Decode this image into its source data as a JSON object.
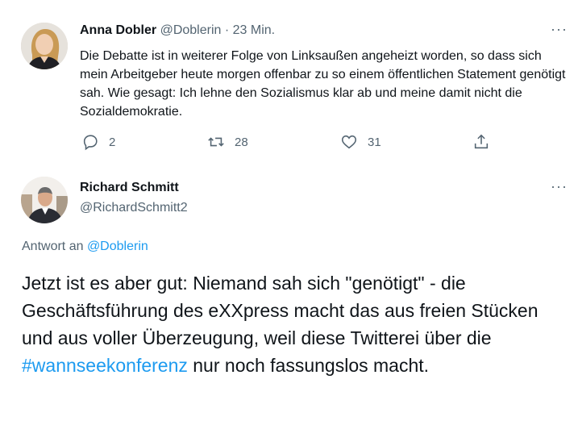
{
  "tweet1": {
    "author_name": "Anna Dobler",
    "handle": "@Doblerin",
    "separator": "·",
    "time": "23 Min.",
    "more": "···",
    "text": "Die Debatte ist in weiterer Folge von Linksaußen angeheizt worden, so dass sich mein Arbeitgeber heute morgen offenbar zu so einem öffentlichen Statement genötigt sah. Wie gesagt: Ich lehne den Sozialismus klar ab und meine damit nicht die Sozialdemokratie.",
    "replies": "2",
    "retweets": "28",
    "likes": "31"
  },
  "tweet2": {
    "author_name": "Richard Schmitt",
    "handle": "@RichardSchmitt2",
    "more": "···",
    "reply_to_label": "Antwort an",
    "reply_to_handle": "@Doblerin",
    "text_before_hashtag": "Jetzt ist es aber gut: Niemand sah sich \"genötigt\" - die Geschäftsführung des eXXpress macht das aus freien Stücken und aus voller Überzeugung, weil diese Twitterei über die ",
    "hashtag": "#wannseekonferenz",
    "text_after_hashtag": " nur noch fassungslos macht."
  },
  "colors": {
    "accent": "#1d9bf0",
    "secondary_text": "#536471",
    "primary_text": "#0f1419"
  },
  "icons": [
    "reply-icon",
    "retweet-icon",
    "like-icon",
    "share-icon",
    "more-icon"
  ]
}
